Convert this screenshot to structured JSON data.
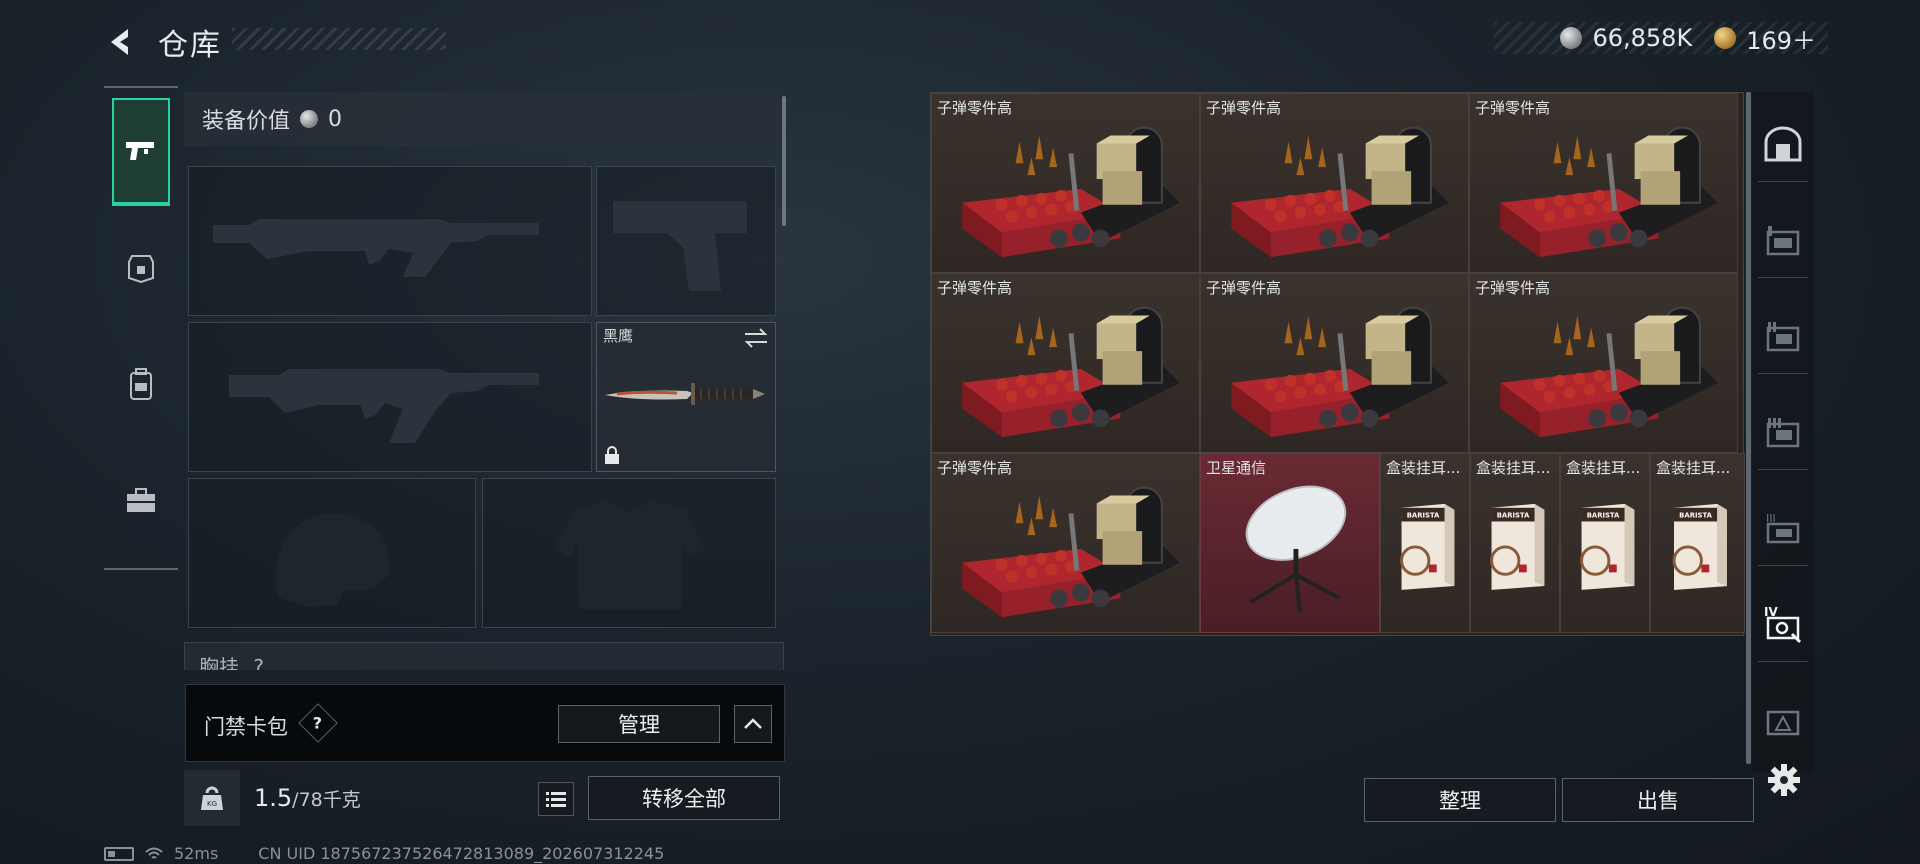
{
  "header": {
    "title": "仓库",
    "currency_silver": "66,858K",
    "currency_gold": "169＋"
  },
  "left_rail": {
    "items": [
      {
        "icon": "pistol-icon",
        "active": true
      },
      {
        "icon": "armor-plate-icon",
        "active": false
      },
      {
        "icon": "backpack-icon",
        "active": false
      },
      {
        "icon": "toolbox-icon",
        "active": false
      }
    ]
  },
  "equipment": {
    "value_label": "装备价值",
    "value": "0",
    "knife_label": "黑鹰",
    "vest_label": "胸挂",
    "vest_count": "?"
  },
  "keycard": {
    "label": "门禁卡包",
    "help": "?",
    "manage_label": "管理"
  },
  "weight": {
    "current": "1.5",
    "capacity": "/78千克",
    "icon_text": "KG",
    "transfer_all_label": "转移全部"
  },
  "status": {
    "ping": "52ms",
    "uid": "CN UID 1875672375264728130​89_202607312245"
  },
  "storage": {
    "cells": [
      {
        "label": "子弹零件高",
        "kind": "ammo"
      },
      {
        "label": "子弹零件高",
        "kind": "ammo"
      },
      {
        "label": "子弹零件高",
        "kind": "ammo"
      },
      {
        "label": "子弹零件高",
        "kind": "ammo"
      },
      {
        "label": "子弹零件高",
        "kind": "ammo"
      },
      {
        "label": "子弹零件高",
        "kind": "ammo"
      },
      {
        "label": "子弹零件高",
        "kind": "ammo"
      },
      {
        "label": "卫星通信",
        "kind": "satellite"
      },
      {
        "label": "盒装挂耳...",
        "kind": "coffee",
        "brand": "BARISTA"
      },
      {
        "label": "盒装挂耳...",
        "kind": "coffee",
        "brand": "BARISTA"
      },
      {
        "label": "盒装挂耳...",
        "kind": "coffee",
        "brand": "BARISTA"
      },
      {
        "label": "盒装挂耳...",
        "kind": "coffee",
        "brand": "BARISTA"
      }
    ],
    "sort_label": "整理",
    "sell_label": "出售"
  },
  "right_rail": {
    "items": [
      {
        "icon": "safe-box-icon"
      },
      {
        "icon": "crate-tier-1-icon"
      },
      {
        "icon": "crate-tier-2-icon"
      },
      {
        "icon": "crate-tier-3-icon"
      },
      {
        "icon": "crate-tier-3b-icon",
        "tier": "III"
      },
      {
        "icon": "crate-tier-4-icon",
        "tier": "IV"
      },
      {
        "icon": "crate-tier-5-icon"
      }
    ]
  }
}
